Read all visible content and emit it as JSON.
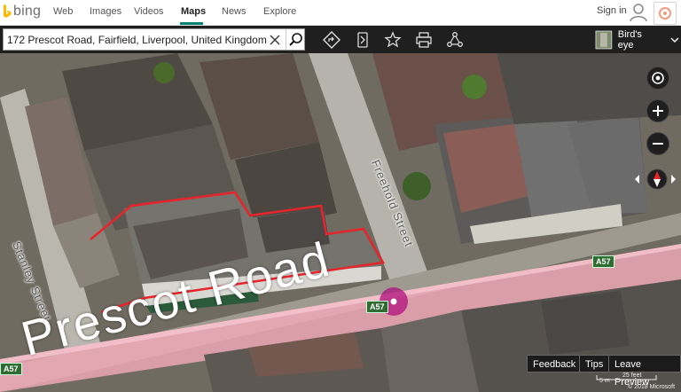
{
  "nav": {
    "logo_text": "bing",
    "items": [
      {
        "label": "Web",
        "active": false
      },
      {
        "label": "Images",
        "active": false
      },
      {
        "label": "Videos",
        "active": false
      },
      {
        "label": "Maps",
        "active": true
      },
      {
        "label": "News",
        "active": false
      },
      {
        "label": "Explore",
        "active": false
      }
    ],
    "signin": "Sign in"
  },
  "toolbar": {
    "search_value": "172 Prescot Road, Fairfield, Liverpool, United Kingdom",
    "view_mode": "Bird's eye",
    "tools": [
      "directions-icon",
      "traffic-icon",
      "favorites-star-icon",
      "print-icon",
      "share-icon"
    ]
  },
  "map": {
    "road_label": "Prescot Road",
    "street_labels": [
      "Stanley Street",
      "Freehold Street"
    ],
    "route_shields": [
      "A57",
      "A57",
      "A57"
    ],
    "highlight_color": "#e8242a",
    "road_overlay_color": "#f2a9b8",
    "pin_color": "#b0107d"
  },
  "controls": {
    "zoom_in": "+",
    "zoom_out": "−"
  },
  "footer": {
    "buttons": [
      "Feedback",
      "Tips",
      "Leave Preview"
    ],
    "scale": "25 feet",
    "scale_metric": "5 m",
    "copyright": "© 2018 Microsoft"
  }
}
